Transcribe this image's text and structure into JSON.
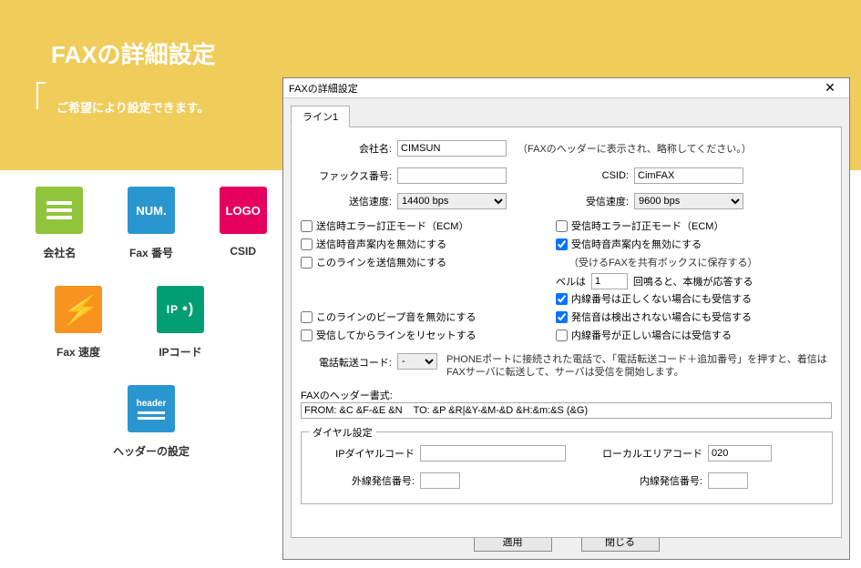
{
  "page": {
    "title": "FAXの詳細設定",
    "subtitle": "ご希望により設定できます。"
  },
  "sidebar": {
    "items": [
      {
        "label": "会社名",
        "badge": "≡"
      },
      {
        "label": "Fax 番号",
        "badge": "NUM."
      },
      {
        "label": "CSID",
        "badge": "LOGO"
      },
      {
        "label": "Fax 速度",
        "badge": "⚡"
      },
      {
        "label": "IPコード",
        "badge": "IP •))"
      },
      {
        "label": "ヘッダーの設定",
        "badge": "header"
      }
    ]
  },
  "dialog": {
    "title": "FAXの詳細設定",
    "tab": "ライン1",
    "company_label": "会社名:",
    "company_value": "CIMSUN",
    "company_note": "（FAXのヘッダーに表示され、略称してください。）",
    "fax_no_label": "ファックス番号:",
    "fax_no_value": "",
    "csid_label": "CSID:",
    "csid_value": "CimFAX",
    "send_speed_label": "送信速度:",
    "send_speed_value": "14400 bps",
    "recv_speed_label": "受信速度:",
    "recv_speed_value": "9600 bps",
    "cb_send_ecm": "送信時エラー訂正モード（ECM）",
    "cb_send_voice": "送信時音声案内を無効にする",
    "cb_send_disable": "このラインを送信無効にする",
    "cb_recv_ecm": "受信時エラー訂正モード（ECM）",
    "cb_recv_voice": "受信時音声案内を無効にする",
    "recv_share_note": "（受けるFAXを共有ボックスに保存する）",
    "bell_prefix": "ベルは",
    "bell_value": "1",
    "bell_suffix": "回鳴ると、本機が応答する",
    "cb_recv_badext": "内線番号は正しくない場合にも受信する",
    "cb_recv_nobeep": "発信音は検出されない場合にも受信する",
    "cb_recv_goodext": "内線番号が正しい場合には受信する",
    "cb_beep_disable": "このラインのビープ音を無効にする",
    "cb_reset_after": "受信してからラインをリセットする",
    "tel_code_label": "電話転送コード:",
    "tel_code_value": " - ",
    "tel_code_help": "PHONEポートに接続された電話で、「電話転送コード＋追加番号」を押すと、着信はFAXサーバに転送して、サーバは受信を開始します。",
    "header_fmt_label": "FAXのヘッダー書式:",
    "header_fmt_value": "FROM: &C &F-&E &N    TO: &P &R|&Y-&M-&D &H:&m:&S (&G)",
    "dial_group": "ダイヤル設定",
    "ip_dial_label": "IPダイヤルコード",
    "ip_dial_value": "",
    "local_area_label": "ローカルエリアコード",
    "local_area_value": "020",
    "out_prefix_label": "外線発信番号:",
    "out_prefix_value": "",
    "in_prefix_label": "内線発信番号:",
    "in_prefix_value": "",
    "apply_btn": "適用",
    "close_btn": "閉じる"
  }
}
